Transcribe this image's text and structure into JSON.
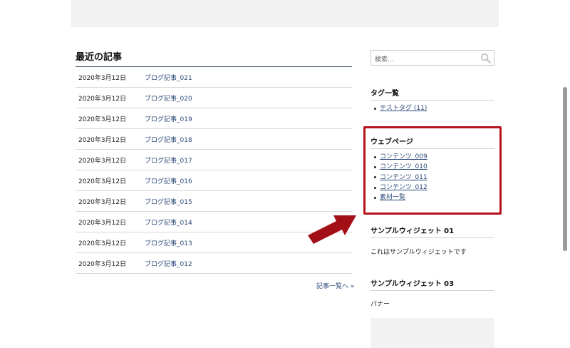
{
  "recent": {
    "title": "最近の記事",
    "posts": [
      {
        "date": "2020年3月12日",
        "title": "ブログ記事_021"
      },
      {
        "date": "2020年3月12日",
        "title": "ブログ記事_020"
      },
      {
        "date": "2020年3月12日",
        "title": "ブログ記事_019"
      },
      {
        "date": "2020年3月12日",
        "title": "ブログ記事_018"
      },
      {
        "date": "2020年3月12日",
        "title": "ブログ記事_017"
      },
      {
        "date": "2020年3月12日",
        "title": "ブログ記事_016"
      },
      {
        "date": "2020年3月12日",
        "title": "ブログ記事_015"
      },
      {
        "date": "2020年3月12日",
        "title": "ブログ記事_014"
      },
      {
        "date": "2020年3月12日",
        "title": "ブログ記事_013"
      },
      {
        "date": "2020年3月12日",
        "title": "ブログ記事_012"
      }
    ],
    "more_link": "記事一覧へ »"
  },
  "search": {
    "placeholder": "検索...",
    "icon": "search-icon"
  },
  "sidebar": {
    "tags": {
      "title": "タグ一覧",
      "items": [
        "テストタグ (11)"
      ]
    },
    "webpages": {
      "title": "ウェブページ",
      "items": [
        "コンテンツ_009",
        "コンテンツ_010",
        "コンテンツ_011",
        "コンテンツ_012",
        "素材一覧"
      ]
    },
    "widget01": {
      "title": "サンプルウィジェット 01",
      "text": "これはサンプルウィジェットです"
    },
    "widget03": {
      "title": "サンプルウィジェット 03",
      "text": "バナー"
    }
  },
  "colors": {
    "highlight": "#b5121b",
    "link": "#2c4a78"
  }
}
